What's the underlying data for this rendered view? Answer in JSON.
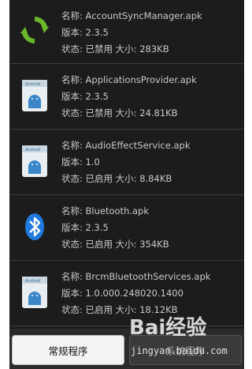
{
  "apps": [
    {
      "icon": "sync-icon",
      "name": "名称: AccountSyncManager.apk",
      "version": "版本: 2.3.5",
      "status": "状态: 已禁用 大小: 283KB"
    },
    {
      "icon": "android-package-icon",
      "name": "名称: ApplicationsProvider.apk",
      "version": "版本: 2.3.5",
      "status": "状态: 已禁用 大小: 24.81KB"
    },
    {
      "icon": "android-package-icon",
      "name": "名称: AudioEffectService.apk",
      "version": "版本: 1.0",
      "status": "状态: 已启用 大小: 8.84KB"
    },
    {
      "icon": "bluetooth-icon",
      "name": "名称: Bluetooth.apk",
      "version": "版本: 2.3.5",
      "status": "状态: 已启用 大小: 354KB"
    },
    {
      "icon": "android-package-icon",
      "name": "名称: BrcmBluetoothServices.apk",
      "version": "版本: 1.0.000.248020.1400",
      "status": "状态: 已启用 大小: 18.12KB"
    }
  ],
  "bottom": {
    "left_button": "常规程序",
    "right_button": "系统程序"
  },
  "watermark": {
    "brand": "Bai经验",
    "url": "jingyan.baidu.com"
  },
  "colors": {
    "background": "#1c1c1c",
    "text": "#c8c8c8",
    "accent_green": "#6ab82a",
    "bluetooth_blue": "#1f7ae0"
  }
}
